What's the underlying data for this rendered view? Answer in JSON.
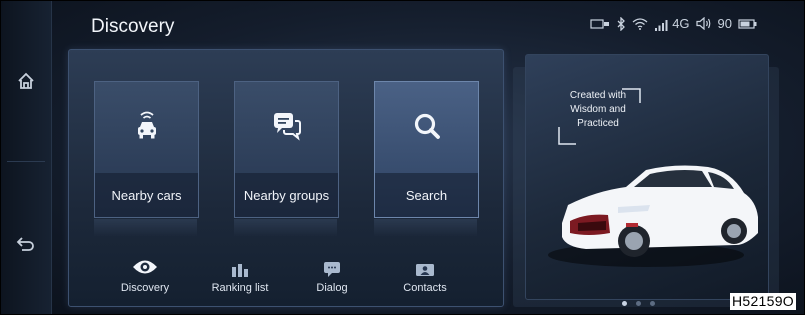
{
  "header": {
    "title": "Discovery"
  },
  "status": {
    "network": "4G",
    "volume": "90"
  },
  "tiles": [
    {
      "label": "Nearby cars"
    },
    {
      "label": "Nearby groups"
    },
    {
      "label": "Search"
    }
  ],
  "tabs": [
    {
      "label": "Discovery"
    },
    {
      "label": "Ranking list"
    },
    {
      "label": "Dialog"
    },
    {
      "label": "Contacts"
    }
  ],
  "promo": {
    "line1": "Created with",
    "line2": "Wisdom and",
    "line3": "Practiced"
  },
  "carousel": {
    "page_count": 3,
    "current": 1
  },
  "image_code": "H52159O",
  "colors": {
    "accent": "#c9d6e8",
    "panel": "#1d293b"
  },
  "icons": [
    "home-icon",
    "back-icon",
    "usb-icon",
    "bluetooth-icon",
    "wifi-icon",
    "signal-icon",
    "volume-icon",
    "battery-icon",
    "car-icon",
    "chat-icon",
    "search-icon",
    "eye-icon",
    "bar-chart-icon",
    "dialog-icon",
    "contact-card-icon"
  ]
}
